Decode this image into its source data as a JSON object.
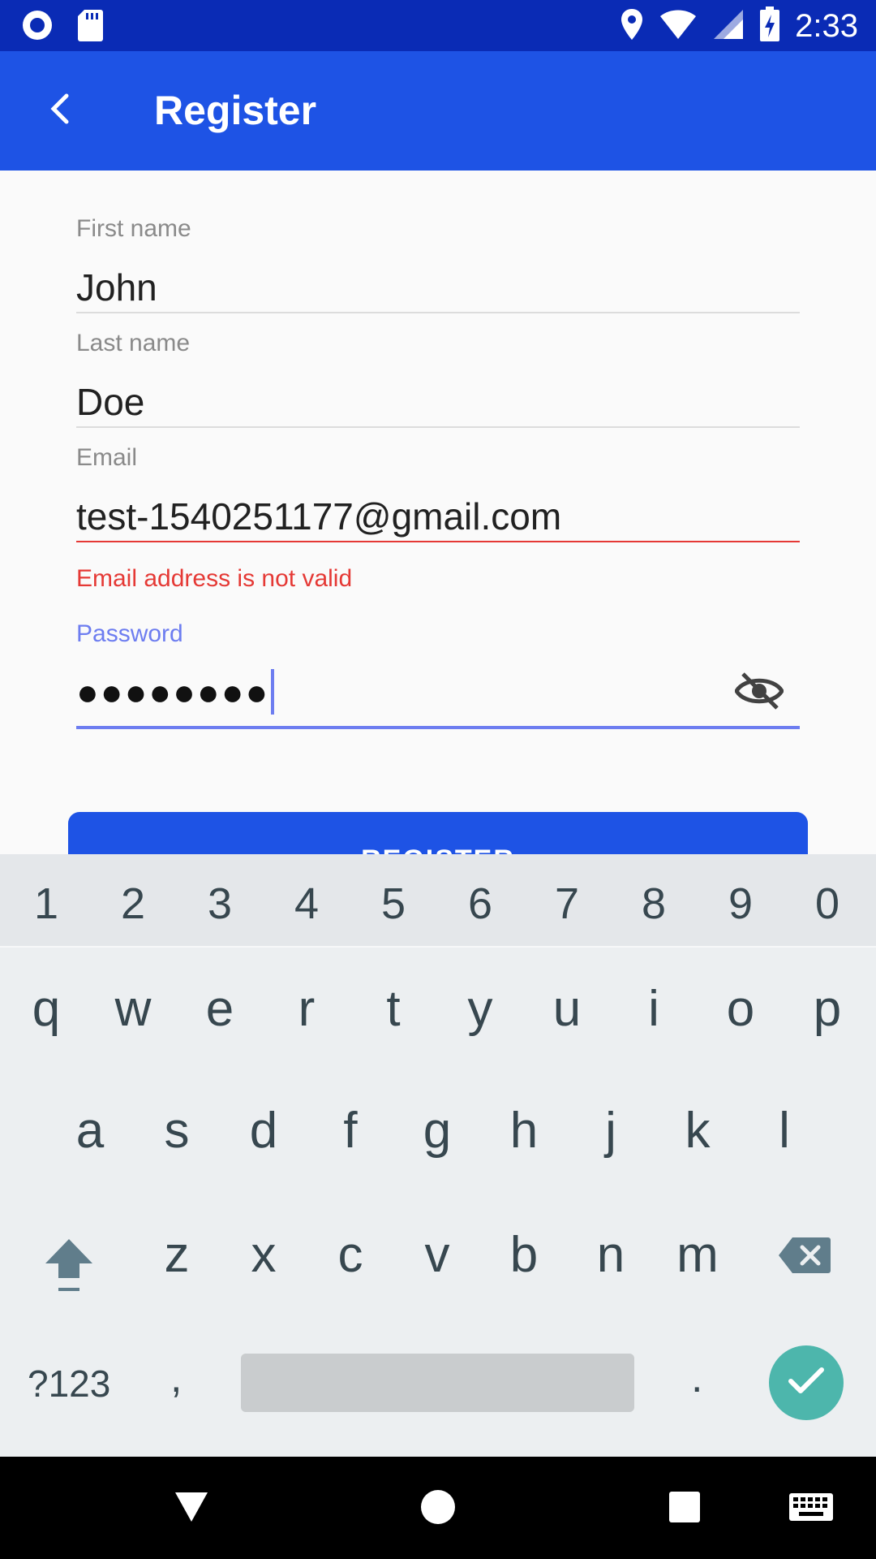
{
  "status_bar": {
    "time": "2:33",
    "left_icons": [
      "circle-dot-icon",
      "sd-card-icon"
    ],
    "right_icons": [
      "location-pin-icon",
      "wifi-icon",
      "cell-signal-icon",
      "battery-charging-icon"
    ]
  },
  "app_bar": {
    "title": "Register",
    "back_icon": "chevron-left-icon",
    "background": "#1e53e5"
  },
  "form": {
    "first_name": {
      "label": "First name",
      "value": "John"
    },
    "last_name": {
      "label": "Last name",
      "value": "Doe"
    },
    "email": {
      "label": "Email",
      "value": "test-1540251177@gmail.com",
      "error": "Email address is not valid"
    },
    "password": {
      "label": "Password",
      "value": "●●●●●●●●",
      "toggle_icon": "eye-off-icon"
    },
    "register_button": {
      "label": "REGISTER"
    }
  },
  "keyboard": {
    "number_row": [
      "1",
      "2",
      "3",
      "4",
      "5",
      "6",
      "7",
      "8",
      "9",
      "0"
    ],
    "row1": [
      "q",
      "w",
      "e",
      "r",
      "t",
      "y",
      "u",
      "i",
      "o",
      "p"
    ],
    "row2": [
      "a",
      "s",
      "d",
      "f",
      "g",
      "h",
      "j",
      "k",
      "l"
    ],
    "row3": [
      "z",
      "x",
      "c",
      "v",
      "b",
      "n",
      "m"
    ],
    "symbols_key": "?123",
    "comma_key": ",",
    "period_key": ".",
    "shift_icon": "shift-arrow-icon",
    "backspace_icon": "backspace-icon",
    "enter_icon": "check-icon",
    "enter_color": "#4db6ac"
  },
  "nav_bar": {
    "back_icon": "triangle-back-icon",
    "home_icon": "circle-home-icon",
    "recents_icon": "square-recents-icon",
    "keyboard_icon": "keyboard-icon"
  },
  "colors": {
    "primary": "#1e53e5",
    "status_bar": "#0a2bb5",
    "error": "#e53935",
    "focus": "#6d7df0"
  }
}
